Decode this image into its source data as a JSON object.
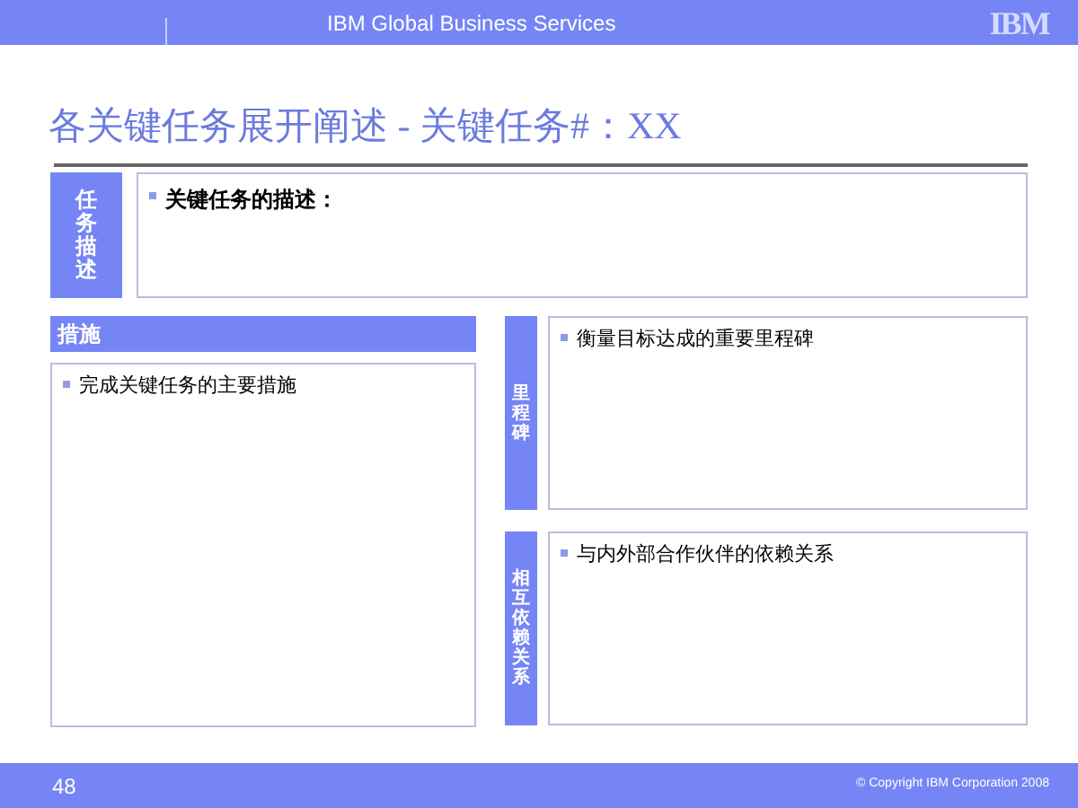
{
  "header": {
    "title": "IBM Global Business Services",
    "logo": "IBM"
  },
  "slide_title": "各关键任务展开阐述 - 关键任务#：XX",
  "task_description": {
    "label": "任务描述",
    "bullet": "关键任务的描述："
  },
  "measures": {
    "label": "措施",
    "bullet": "完成关键任务的主要措施"
  },
  "milestones": {
    "label": "里程碑",
    "bullet": "衡量目标达成的重要里程碑"
  },
  "dependencies": {
    "label": "相互依赖关系",
    "bullet": "与内外部合作伙伴的依赖关系"
  },
  "footer": {
    "page_number": "48",
    "copyright": "© Copyright IBM Corporation 2008"
  }
}
